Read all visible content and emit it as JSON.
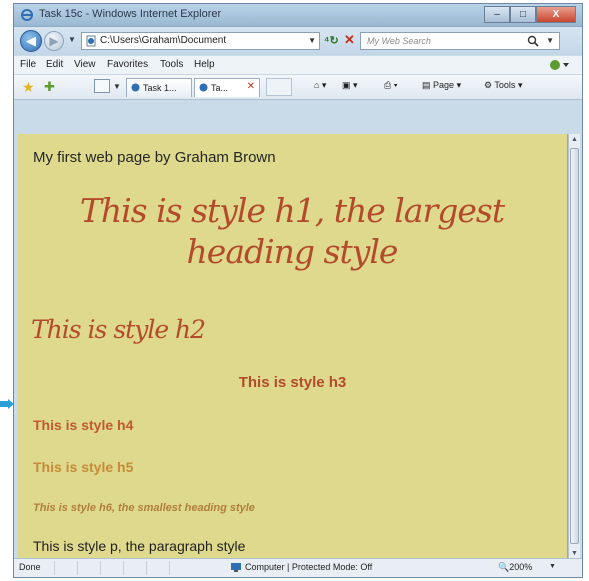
{
  "window": {
    "title": "Task 15c - Windows Internet Explorer",
    "controls": {
      "minimize": "–",
      "maximize": "□",
      "close": "X"
    }
  },
  "address_bar": {
    "url": "C:\\Users\\Graham\\Document",
    "search_placeholder": "My Web Search"
  },
  "menu": {
    "items": [
      "File",
      "Edit",
      "View",
      "Favorites",
      "Tools",
      "Help"
    ]
  },
  "command_bar": {
    "tabs": [
      {
        "label": "Task 1...",
        "active": false
      },
      {
        "label": "Ta...",
        "active": true
      }
    ],
    "page_label": "Page",
    "tools_label": "Tools"
  },
  "page": {
    "title_text": "My first web page by Graham Brown",
    "h1": "This is style h1, the largest heading style",
    "h2": "This is style h2",
    "h3": "This is style h3",
    "h4": "This is style h4",
    "h5": "This is style h5",
    "h6": "This is style h6, the smallest heading style",
    "p": "This is style p, the paragraph style",
    "background_color": "#ded98c",
    "heading_color": "#b34a2b"
  },
  "status_bar": {
    "status": "Done",
    "zone": "Computer | Protected Mode: Off",
    "zoom": "200%"
  },
  "icons": {
    "app": "ie-logo-icon",
    "back": "back-arrow-icon",
    "forward": "forward-arrow-icon",
    "refresh": "refresh-icon",
    "stop": "stop-icon",
    "search": "search-magnifier-icon",
    "favorites": "favorites-star-icon",
    "add_favorites": "add-favorites-icon",
    "zone": "computer-zone-icon"
  },
  "accent_colors": {
    "titlebar": "#9ab8d3",
    "callout_arrow": "#2b9fd6"
  }
}
